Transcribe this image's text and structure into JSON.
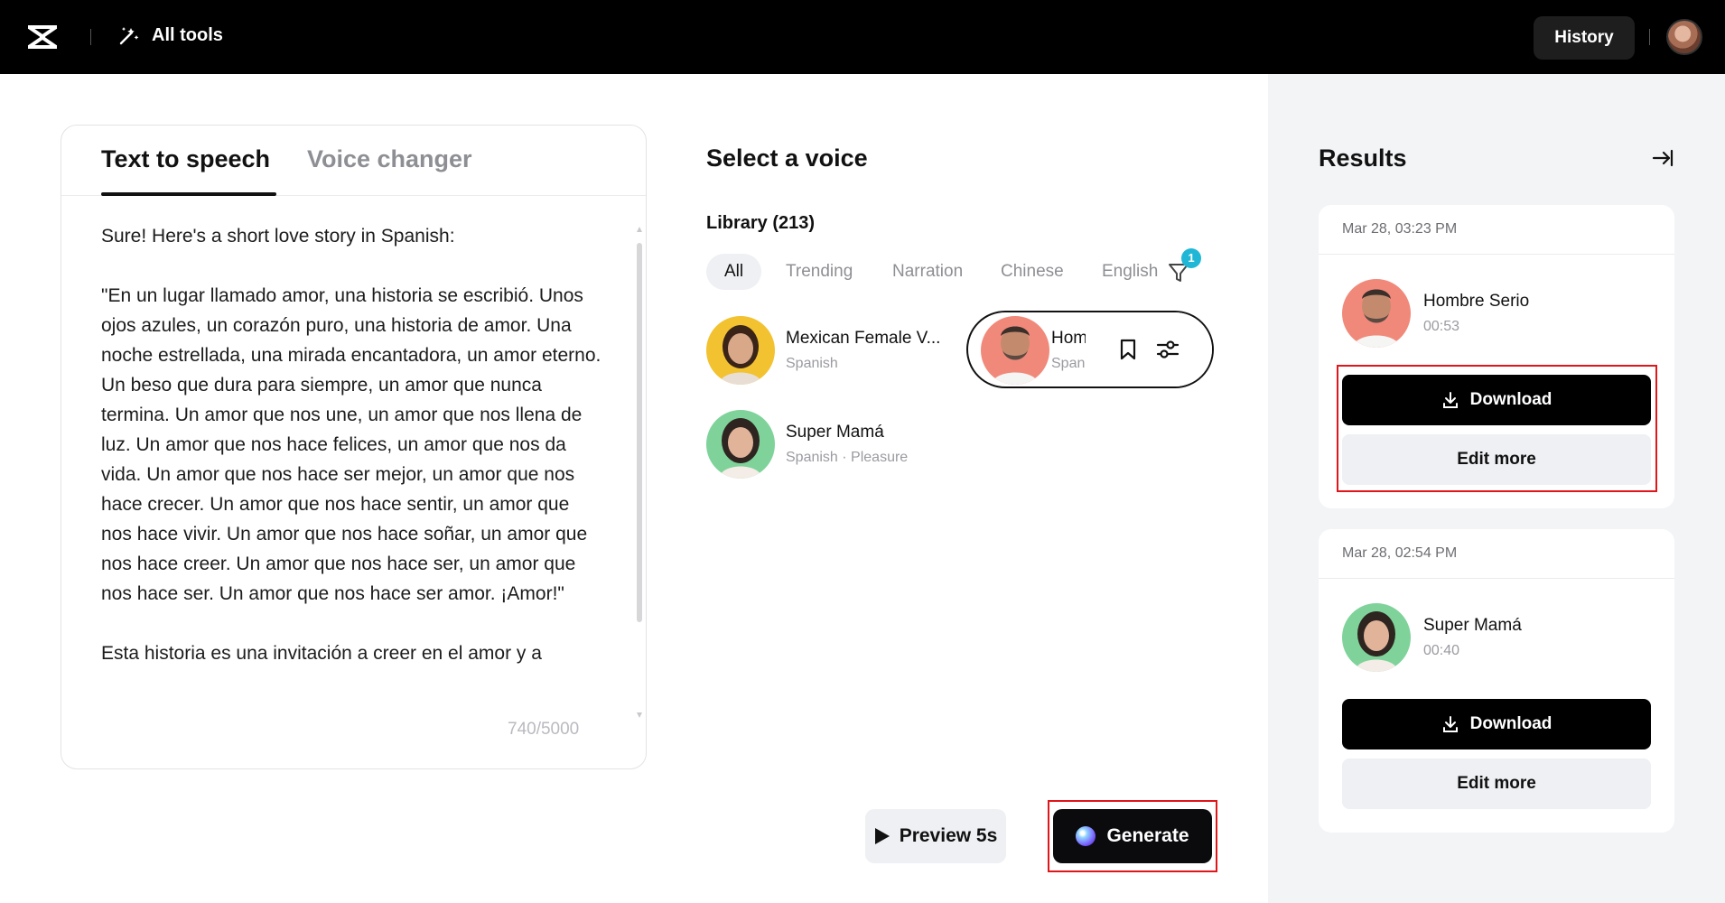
{
  "topbar": {
    "logo_icon": "capcut-logo-icon",
    "all_tools_label": "All tools",
    "history_label": "History"
  },
  "editor": {
    "tabs": [
      {
        "label": "Text to speech",
        "active": true
      },
      {
        "label": "Voice changer",
        "active": false
      }
    ],
    "paragraphs": [
      "Sure! Here's a short love story in Spanish:",
      "\"En un lugar llamado amor, una historia se escribió. Unos ojos azules, un corazón puro, una historia de amor. Una noche estrellada, una mirada encantadora, un amor eterno. Un beso que dura para siempre, un amor que nunca termina. Un amor que nos une, un amor que nos llena de luz. Un amor que nos hace felices, un amor que nos da vida. Un amor que nos hace ser mejor, un amor que nos hace crecer. Un amor que nos hace sentir, un amor que nos hace vivir. Un amor que nos hace soñar, un amor que nos hace creer. Un amor que nos hace ser, un amor que nos hace ser. Un amor que nos hace ser amor. ¡Amor!\"",
      "Esta historia es una invitación a creer en el amor y a"
    ],
    "char_count": "740/5000"
  },
  "voices": {
    "title": "Select a voice",
    "library_label": "Library (213)",
    "filters": [
      "All",
      "Trending",
      "Narration",
      "Chinese",
      "English"
    ],
    "active_filter": "All",
    "filter_badge": "1",
    "items": [
      {
        "name": "Mexican Female V...",
        "sub": "Spanish"
      },
      {
        "name": "Hombre Serio",
        "sub": "Spanish"
      },
      {
        "name": "Super Mamá",
        "sub": "Spanish · Pleasure"
      }
    ]
  },
  "actions": {
    "preview_label": "Preview 5s",
    "generate_label": "Generate"
  },
  "results": {
    "title": "Results",
    "items": [
      {
        "date": "Mar 28, 03:23 PM",
        "name": "Hombre Serio",
        "duration": "00:53",
        "download_label": "Download",
        "edit_label": "Edit more"
      },
      {
        "date": "Mar 28, 02:54 PM",
        "name": "Super Mamá",
        "duration": "00:40",
        "download_label": "Download",
        "edit_label": "Edit more"
      }
    ]
  },
  "colors": {
    "accent_badge": "#20b7d6",
    "highlight": "#e0161b",
    "avatar_female_bg": "#f2c230",
    "avatar_male_bg": "#f1897a",
    "avatar_mom_bg": "#7fd39a"
  }
}
